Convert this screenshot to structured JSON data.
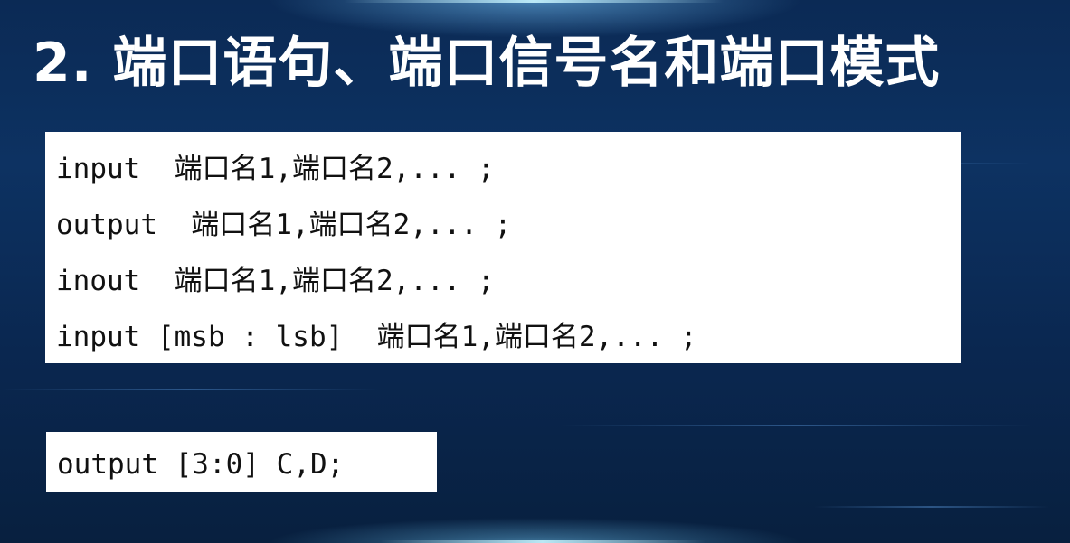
{
  "slide": {
    "title": "2. 端口语句、端口信号名和端口模式",
    "syntax_lines": [
      "input  端口名1,端口名2,... ;",
      "output  端口名1,端口名2,... ;",
      "inout  端口名1,端口名2,... ;",
      "input [msb : lsb]  端口名1,端口名2,... ;"
    ],
    "example_line": "output [3:0] C,D;"
  },
  "colors": {
    "background": "#0b2a55",
    "title_text": "#ffffff",
    "code_box": "#ffffff",
    "code_text": "#111111"
  }
}
